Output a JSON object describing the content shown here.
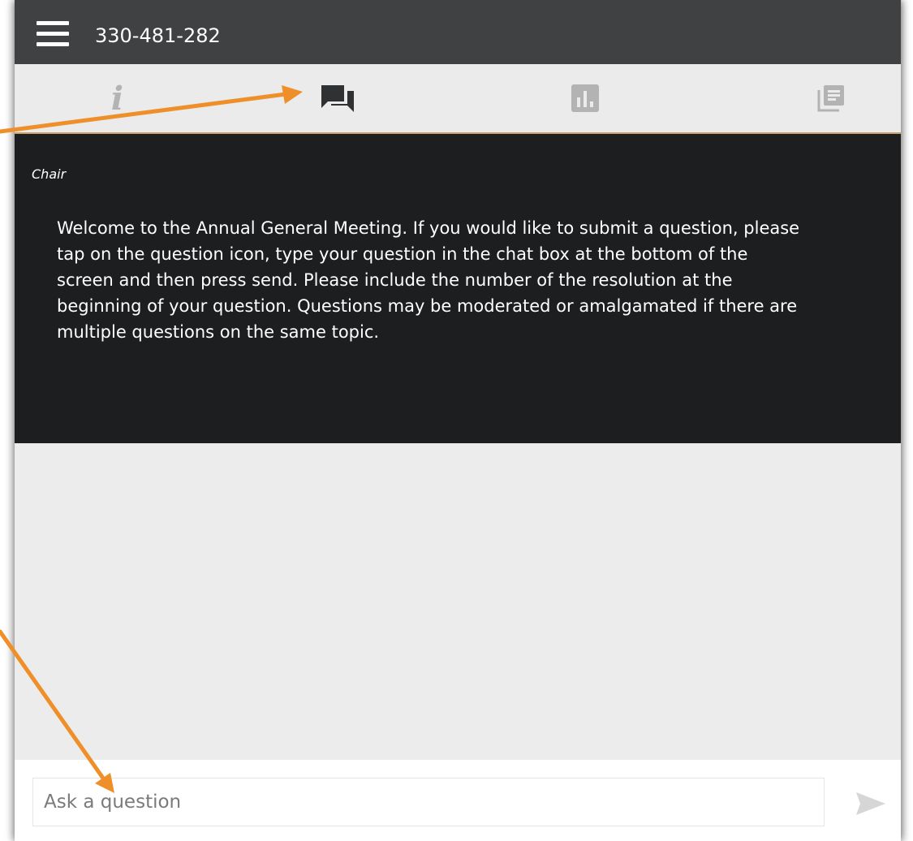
{
  "header": {
    "meeting_id": "330-481-282",
    "menu_icon": "hamburger-menu-icon"
  },
  "tabs": [
    {
      "name": "info",
      "icon": "info-icon",
      "glyph": "i",
      "active": false
    },
    {
      "name": "messaging",
      "icon": "chat-bubbles-icon",
      "active": true
    },
    {
      "name": "voting",
      "icon": "bar-chart-icon",
      "active": false
    },
    {
      "name": "documents",
      "icon": "documents-icon",
      "active": false
    }
  ],
  "message": {
    "author": "Chair",
    "text": "Welcome to the Annual General Meeting. If you would like to submit a question, please tap on the question icon, type your question in the chat box at the bottom of the screen and then press send. Please include the number of the resolution at the beginning of your question. Questions may be moderated or amalgamated if there are multiple questions on the same topic."
  },
  "input": {
    "placeholder": "Ask a question",
    "value": "",
    "send_icon": "send-icon"
  },
  "colors": {
    "topbar": "#3f4142",
    "tabbar": "#ebebeb",
    "tab_active": "#3f4142",
    "tab_inactive": "#b3b3b3",
    "tab_underline": "#c9a06a",
    "message_bg": "#1d1e1f",
    "chat_bg": "#ececec",
    "annotation_arrow": "#ef8f2a"
  }
}
